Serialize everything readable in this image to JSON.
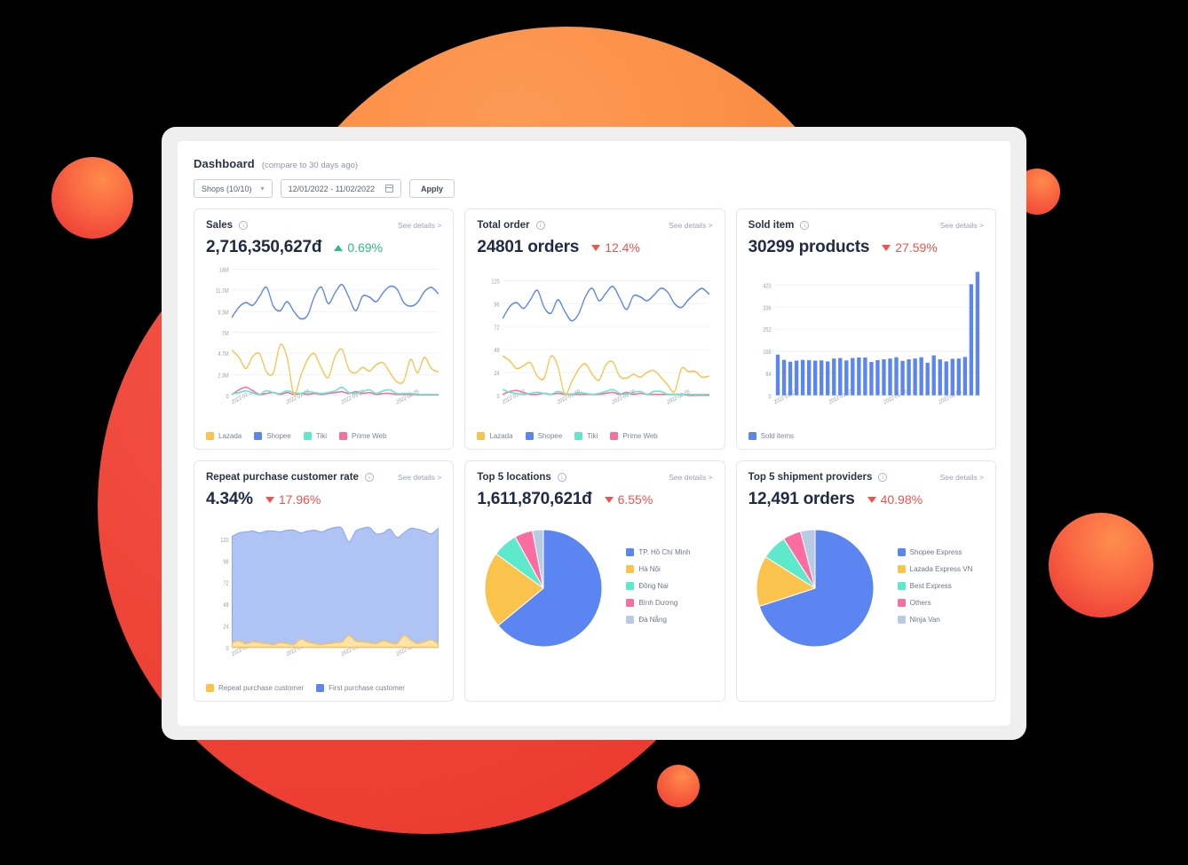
{
  "header": {
    "title": "Dashboard",
    "subtitle": "(compare to 30 days ago)"
  },
  "toolbar": {
    "shops_value": "Shops (10/10)",
    "chevron": "chevron-down-icon",
    "date_range_value": "12/01/2022 - 11/02/2022",
    "calendar_icon": "calendar-icon",
    "apply_label": "Apply"
  },
  "common": {
    "see_details": "See details >",
    "info_icon": "i"
  },
  "colors": {
    "lazada": "#FBC34B",
    "shopee": "#5B85F0",
    "tiki": "#5EE8CC",
    "prime_web": "#FB6DA0",
    "sold_items": "#5B85F0",
    "repeat_customer": "#FBC34B",
    "first_customer": "#5B85F0",
    "pie_blue": "#5B85F0",
    "pie_yellow": "#FBC34B",
    "pie_teal": "#5EE8CC",
    "pie_pink": "#FB6DA0",
    "pie_grey": "#B9CBE2",
    "up": "#29BF7E",
    "down": "#F4514A"
  },
  "cards": [
    {
      "id": "sales",
      "title": "Sales",
      "value": "2,716,350,627đ",
      "delta": "0.69%",
      "delta_dir": "up",
      "legend": [
        {
          "label": "Lazada",
          "color": "#FBC34B"
        },
        {
          "label": "Shopee",
          "color": "#5B85F0"
        },
        {
          "label": "Tiki",
          "color": "#5EE8CC"
        },
        {
          "label": "Prime Web",
          "color": "#FB6DA0"
        }
      ]
    },
    {
      "id": "total-order",
      "title": "Total order",
      "value": "24801 orders",
      "delta": "12.4%",
      "delta_dir": "down",
      "legend": [
        {
          "label": "Lazada",
          "color": "#FBC34B"
        },
        {
          "label": "Shopee",
          "color": "#5B85F0"
        },
        {
          "label": "Tiki",
          "color": "#5EE8CC"
        },
        {
          "label": "Prime Web",
          "color": "#FB6DA0"
        }
      ]
    },
    {
      "id": "sold-item",
      "title": "Sold item",
      "value": "30299 products",
      "delta": "27.59%",
      "delta_dir": "down",
      "legend": [
        {
          "label": "Sold items",
          "color": "#5B85F0"
        }
      ]
    },
    {
      "id": "repeat-purchase",
      "title": "Repeat purchase customer rate",
      "value": "4.34%",
      "delta": "17.96%",
      "delta_dir": "down",
      "legend": [
        {
          "label": "Repeat purchase customer",
          "color": "#FBC34B"
        },
        {
          "label": "First purchase customer",
          "color": "#5B85F0"
        }
      ]
    },
    {
      "id": "top-locations",
      "title": "Top 5 locations",
      "value": "1,611,870,621đ",
      "delta": "6.55%",
      "delta_dir": "down",
      "legend": [
        {
          "label": "TP. Hồ Chí Minh",
          "color": "#5B85F0"
        },
        {
          "label": "Hà Nội",
          "color": "#FBC34B"
        },
        {
          "label": "Đồng Nai",
          "color": "#5EE8CC"
        },
        {
          "label": "Bình Dương",
          "color": "#FB6DA0"
        },
        {
          "label": "Đà Nẵng",
          "color": "#B9CBE2"
        }
      ]
    },
    {
      "id": "shipment-providers",
      "title": "Top 5 shipment providers",
      "value": "12,491 orders",
      "delta": "40.98%",
      "delta_dir": "down",
      "legend": [
        {
          "label": "Shopee Express",
          "color": "#5B85F0"
        },
        {
          "label": "Lazada Express VN",
          "color": "#FBC34B"
        },
        {
          "label": "Best Express",
          "color": "#5EE8CC"
        },
        {
          "label": "Others",
          "color": "#FB6DA0"
        },
        {
          "label": "Ninja Van",
          "color": "#B9CBE2"
        }
      ]
    }
  ],
  "chart_data": [
    {
      "id": "sales",
      "type": "line",
      "title": "Sales",
      "xlabel": "",
      "ylabel": "",
      "grid": true,
      "legend_position": "bottom",
      "yticks": [
        0,
        2300000,
        4700000,
        7000000,
        9300000,
        11700000,
        14000000
      ],
      "ytick_labels": [
        "0",
        "2.3M",
        "4.7M",
        "7M",
        "9.3M",
        "11.7M",
        "14M"
      ],
      "ylim": [
        0,
        14000000
      ],
      "xtick_labels": [
        "2022-01-12",
        "2022-01-20",
        "2022-01-28",
        "2022-02-05"
      ],
      "xtick_positions": [
        0,
        8,
        16,
        24
      ],
      "x_count": 31,
      "series": [
        {
          "name": "Shopee",
          "color": "#5B85F0",
          "values": [
            8.7,
            9.8,
            10.3,
            10.0,
            11.0,
            12.0,
            9.9,
            9.4,
            10.4,
            9.3,
            8.5,
            8.9,
            11.0,
            12.0,
            10.2,
            11.4,
            12.3,
            10.9,
            9.4,
            11.0,
            10.9,
            10.4,
            11.4,
            12.1,
            11.8,
            10.3,
            9.9,
            10.3,
            11.5,
            12.0,
            11.3
          ]
        },
        {
          "name": "Lazada",
          "color": "#FBC34B",
          "values": [
            5.0,
            4.2,
            3.0,
            4.3,
            4.6,
            2.6,
            2.5,
            5.6,
            4.2,
            0.1,
            2.2,
            4.0,
            4.6,
            3.0,
            2.0,
            4.3,
            5.1,
            2.9,
            2.5,
            3.1,
            2.7,
            3.4,
            3.6,
            2.5,
            1.5,
            1.6,
            4.0,
            2.5,
            4.2,
            3.0,
            2.6
          ]
        },
        {
          "name": "Tiki",
          "color": "#5EE8CC",
          "values": [
            0.15,
            0.3,
            0.5,
            0.25,
            0.1,
            0.5,
            0.3,
            0.2,
            0.5,
            0.3,
            0.2,
            0.4,
            0.3,
            0.2,
            0.3,
            0.5,
            0.9,
            0.3,
            0.2,
            0.4,
            0.6,
            0.2,
            0.5,
            0.6,
            0.2,
            0.2,
            0.2,
            0.1,
            0.1,
            0.1,
            0.1
          ]
        },
        {
          "name": "Prime Web",
          "color": "#FB6DA0",
          "values": [
            0.1,
            0.6,
            0.9,
            0.5,
            0.1,
            0.2,
            0.3,
            0.1,
            0.3,
            0.1,
            0.2,
            0.1,
            0.2,
            0.1,
            0.2,
            0.3,
            0.4,
            0.2,
            0.4,
            0.2,
            0.3,
            0.1,
            0.2,
            0.2,
            0.1,
            0.1,
            0.1,
            0.05,
            0.05,
            0.05,
            0.05
          ]
        }
      ]
    },
    {
      "id": "total-order",
      "type": "line",
      "title": "Total order",
      "grid": true,
      "legend_position": "bottom",
      "yticks": [
        0,
        24,
        48,
        72,
        96,
        120
      ],
      "ytick_labels": [
        "0",
        "24",
        "48",
        "72",
        "96",
        "120"
      ],
      "ylim": [
        0,
        132
      ],
      "xtick_labels": [
        "2022-01-12",
        "2022-01-20",
        "2022-01-28",
        "2022-02-05"
      ],
      "xtick_positions": [
        0,
        8,
        16,
        24
      ],
      "x_count": 31,
      "series": [
        {
          "name": "Shopee",
          "color": "#5B85F0",
          "values": [
            81,
            93,
            97,
            91,
            100,
            110,
            92,
            86,
            100,
            88,
            78,
            85,
            103,
            112,
            99,
            107,
            114,
            102,
            90,
            104,
            103,
            99,
            105,
            112,
            108,
            96,
            92,
            100,
            107,
            112,
            106
          ]
        },
        {
          "name": "Lazada",
          "color": "#FBC34B",
          "values": [
            41,
            36,
            28,
            31,
            34,
            20,
            18,
            41,
            30,
            1,
            14,
            27,
            33,
            22,
            16,
            32,
            35,
            20,
            18,
            22,
            19,
            24,
            26,
            19,
            11,
            4,
            28,
            25,
            25,
            19,
            20
          ]
        },
        {
          "name": "Tiki",
          "color": "#5EE8CC",
          "values": [
            6,
            3,
            2,
            1,
            2,
            3,
            2,
            1,
            4,
            2,
            1,
            3,
            2,
            1,
            2,
            4,
            6,
            2,
            1,
            3,
            4,
            1,
            4,
            4,
            1,
            1,
            1,
            1,
            1,
            1,
            1
          ]
        },
        {
          "name": "Prime Web",
          "color": "#FB6DA0",
          "values": [
            1,
            4,
            5,
            3,
            1,
            1,
            2,
            1,
            2,
            1,
            1,
            1,
            1,
            1,
            1,
            2,
            3,
            1,
            3,
            1,
            2,
            1,
            1,
            1,
            1,
            1,
            1,
            0,
            0,
            0,
            0
          ]
        }
      ]
    },
    {
      "id": "sold-item",
      "type": "bar",
      "title": "Sold item",
      "grid": true,
      "legend_position": "bottom",
      "yticks": [
        0,
        84,
        168,
        252,
        336,
        420
      ],
      "ytick_labels": [
        "0",
        "84",
        "168",
        "252",
        "336",
        "420"
      ],
      "ylim": [
        0,
        480
      ],
      "xtick_labels": [
        "2022-01-12",
        "2022-01-20",
        "2022-01-28",
        "2022-02-05"
      ],
      "xtick_positions": [
        0,
        8,
        16,
        24
      ],
      "categories_count": 31,
      "series": [
        {
          "name": "Sold items",
          "color": "#5B85F0",
          "values": [
            155,
            135,
            128,
            132,
            135,
            134,
            132,
            133,
            129,
            140,
            142,
            133,
            142,
            144,
            144,
            127,
            134,
            137,
            140,
            145,
            131,
            137,
            140,
            145,
            124,
            152,
            137,
            129,
            139,
            140,
            146,
            423,
            470
          ]
        }
      ]
    },
    {
      "id": "repeat-purchase",
      "type": "area",
      "title": "Repeat purchase customer rate",
      "grid": true,
      "legend_position": "bottom",
      "yticks": [
        0,
        24,
        48,
        72,
        96,
        120
      ],
      "ytick_labels": [
        "0",
        "24",
        "48",
        "72",
        "96",
        "120"
      ],
      "ylim": [
        0,
        140
      ],
      "xtick_labels": [
        "2022-01-12",
        "2022-01-20",
        "2022-01-28",
        "2022-02-05"
      ],
      "xtick_positions": [
        0,
        8,
        16,
        24
      ],
      "x_count": 31,
      "series": [
        {
          "name": "Repeat purchase customer",
          "color": "#FBC34B",
          "values": [
            5,
            7,
            4,
            6,
            5,
            4,
            3,
            5,
            4,
            3,
            9,
            6,
            4,
            3,
            4,
            5,
            6,
            13,
            7,
            6,
            5,
            4,
            7,
            5,
            4,
            13,
            8,
            4,
            6,
            8,
            4
          ]
        },
        {
          "name": "First purchase customer",
          "color": "#5B85F0",
          "values": [
            118,
            120,
            124,
            123,
            122,
            125,
            126,
            123,
            126,
            127,
            118,
            123,
            126,
            125,
            127,
            128,
            126,
            104,
            122,
            126,
            128,
            122,
            120,
            126,
            118,
            114,
            124,
            127,
            123,
            118,
            128
          ]
        }
      ]
    },
    {
      "id": "top-locations",
      "type": "pie",
      "title": "Top 5 locations",
      "legend_position": "right",
      "labels": [
        "TP. Hồ Chí Minh",
        "Hà Nội",
        "Đồng Nai",
        "Bình Dương",
        "Đà Nẵng"
      ],
      "values": [
        64,
        21,
        7,
        5,
        3
      ],
      "colors": [
        "#5B85F0",
        "#FBC34B",
        "#5EE8CC",
        "#FB6DA0",
        "#B9CBE2"
      ]
    },
    {
      "id": "shipment-providers",
      "type": "pie",
      "title": "Top 5 shipment providers",
      "legend_position": "right",
      "labels": [
        "Shopee Express",
        "Lazada Express VN",
        "Best Express",
        "Others",
        "Ninja Van"
      ],
      "values": [
        70,
        14,
        7,
        5,
        4
      ],
      "colors": [
        "#5B85F0",
        "#FBC34B",
        "#5EE8CC",
        "#FB6DA0",
        "#B9CBE2"
      ]
    }
  ]
}
